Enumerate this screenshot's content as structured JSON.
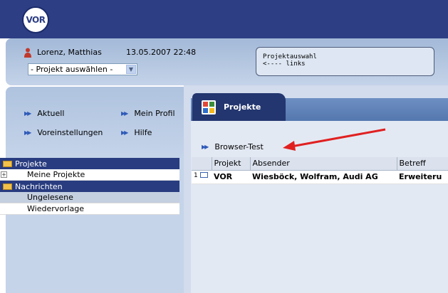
{
  "header": {
    "logo_text": "VOR"
  },
  "user": {
    "name": "Lorenz, Matthias",
    "datetime": "13.05.2007 22:48",
    "project_select": "- Projekt auswählen -"
  },
  "project_note": {
    "text": "Projektauswahl\n<---- links"
  },
  "nav": {
    "links": [
      {
        "label": "Aktuell"
      },
      {
        "label": "Mein Profil"
      },
      {
        "label": "Voreinstellungen"
      },
      {
        "label": "Hilfe"
      }
    ]
  },
  "tree": {
    "projects_header": "Projekte",
    "my_projects": "Meine Projekte",
    "messages_header": "Nachrichten",
    "unread": "Ungelesene",
    "followup": "Wiedervorlage"
  },
  "main": {
    "tab_label": "Projekte",
    "browser_test": "Browser-Test",
    "columns": [
      "",
      "Projekt",
      "Absender",
      "Betreff"
    ],
    "rows": [
      {
        "num": "1",
        "project": "VOR",
        "sender": "Wiesböck, Wolfram, Audi AG",
        "subject": "Erweiteru"
      }
    ]
  },
  "colors": {
    "header_blue": "#2d3e84",
    "tree_header": "#283c7f",
    "annotation_arrow": "#e02020"
  }
}
